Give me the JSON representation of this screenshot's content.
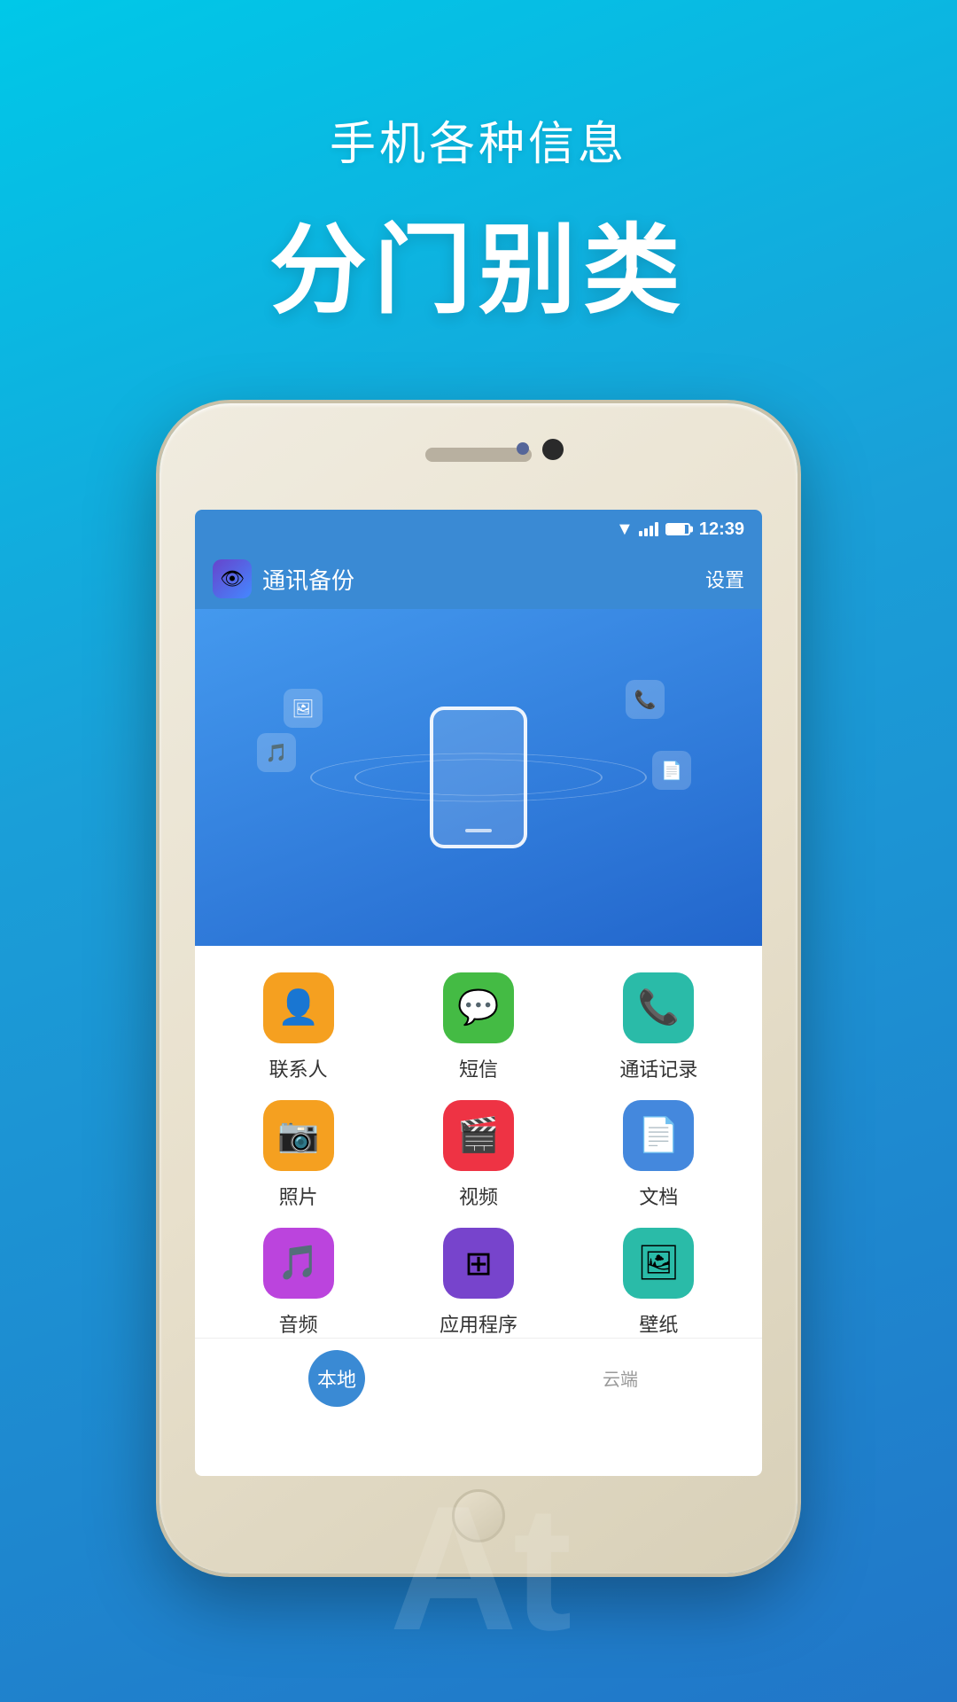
{
  "background": {
    "gradient_start": "#00c8e8",
    "gradient_end": "#2176c8"
  },
  "headline": {
    "subtitle": "手机各种信息",
    "title": "分门别类"
  },
  "phone": {
    "status_bar": {
      "time": "12:39"
    },
    "app_header": {
      "logo_icon": "👁",
      "title": "通讯备份",
      "settings_label": "设置"
    },
    "hero": {
      "floating_icons": [
        "🖼",
        "🎵",
        "📞",
        "📄"
      ]
    },
    "grid": {
      "items": [
        {
          "label": "联系人",
          "icon": "👤",
          "color": "#f5a020"
        },
        {
          "label": "短信",
          "icon": "💬",
          "color": "#44bb44"
        },
        {
          "label": "通话记录",
          "icon": "📞",
          "color": "#2abba8"
        },
        {
          "label": "照片",
          "icon": "📷",
          "color": "#f5a020"
        },
        {
          "label": "视频",
          "icon": "🎬",
          "color": "#ee3344"
        },
        {
          "label": "文档",
          "icon": "📄",
          "color": "#4488dd"
        },
        {
          "label": "音频",
          "icon": "🎵",
          "color": "#bb44dd"
        },
        {
          "label": "应用程序",
          "icon": "⊞",
          "color": "#7744cc"
        },
        {
          "label": "壁纸",
          "icon": "🖼",
          "color": "#2abba8"
        }
      ]
    },
    "bottom_tabs": [
      {
        "label": "本地",
        "active": true
      },
      {
        "label": "云端",
        "active": false
      }
    ]
  },
  "bottom_watermark": "At"
}
